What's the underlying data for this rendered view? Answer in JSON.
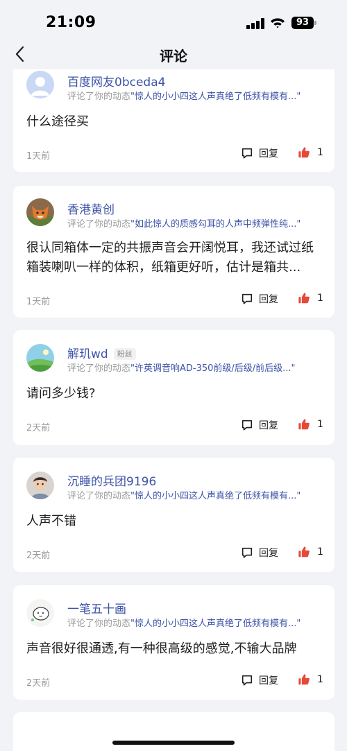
{
  "status_bar": {
    "time": "21:09",
    "battery": "93"
  },
  "nav": {
    "title": "评论"
  },
  "comments": [
    {
      "user": "百度网友0bceda4",
      "action": "评论了你的动态",
      "ref": "\"惊人的小小四这人声真绝了低频有模有...\"",
      "text": "什么途径买",
      "time": "1天前",
      "reply_label": "回复",
      "likes": "1"
    },
    {
      "user": "香港黄创",
      "action": "评论了你的动态",
      "ref": "\"如此惊人的质感勾耳的人声中频弹性纯...\"",
      "text": "很认同箱体一定的共振声音会开阔悦耳，我还试过纸箱装喇叭一样的体积，纸箱更好听，估计是箱共...",
      "time": "1天前",
      "reply_label": "回复",
      "likes": "1"
    },
    {
      "user": "解玑wd",
      "badge": "粉丝",
      "action": "评论了你的动态",
      "ref": "\"许英调音响AD-350前级/后级/前后级...\"",
      "text": "请问多少钱?",
      "time": "2天前",
      "reply_label": "回复",
      "likes": "1"
    },
    {
      "user": "沉睡的兵团9196",
      "action": "评论了你的动态",
      "ref": "\"惊人的小小四这人声真绝了低频有模有...\"",
      "text": "人声不错",
      "time": "2天前",
      "reply_label": "回复",
      "likes": "1"
    },
    {
      "user": "一笔五十画",
      "action": "评论了你的动态",
      "ref": "\"惊人的小小四这人声真绝了低频有模有...\"",
      "text": "声音很好很通透,有一种很高级的感觉,不输大品牌",
      "time": "2天前",
      "reply_label": "回复",
      "likes": "1"
    }
  ],
  "colors": {
    "accent": "#3d54a8",
    "like": "#e8483a",
    "background": "#f2f3f7"
  }
}
